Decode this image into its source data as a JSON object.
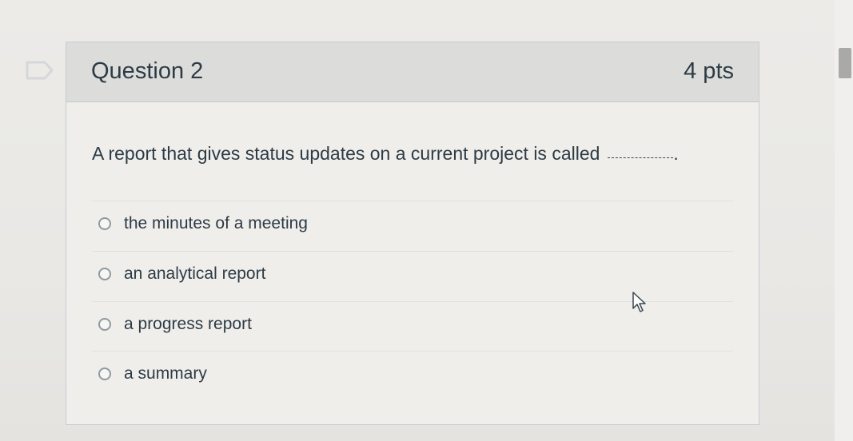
{
  "question": {
    "title": "Question 2",
    "points": "4 pts",
    "text": "A report that gives status updates on a current project is called",
    "trailing_punctuation": ".",
    "answers": [
      {
        "label": "the minutes of a meeting",
        "selected": false
      },
      {
        "label": "an analytical report",
        "selected": false
      },
      {
        "label": "a progress report",
        "selected": false
      },
      {
        "label": "a summary",
        "selected": false
      }
    ]
  },
  "icons": {
    "flag": "flag-icon",
    "radio": "radio-button-icon",
    "cursor": "mouse-pointer-icon"
  },
  "colors": {
    "text": "#2d3b45",
    "header_bg": "#dcdcdb",
    "border": "#c7cdd1",
    "radio_border": "#8f9aa1"
  }
}
